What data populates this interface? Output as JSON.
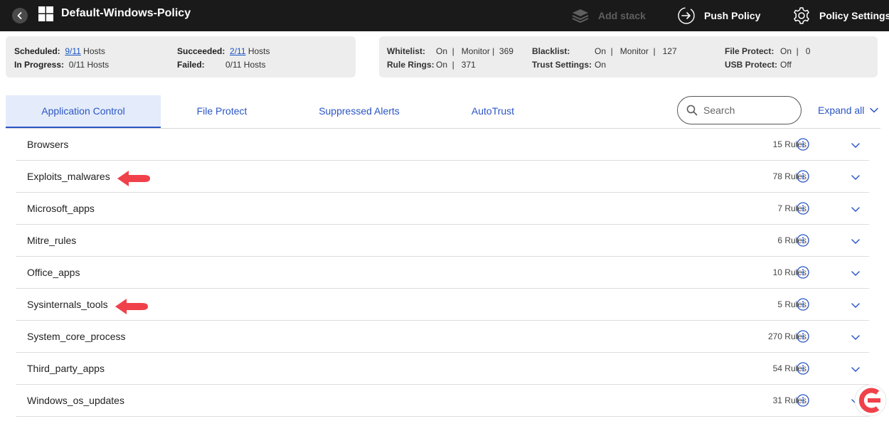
{
  "header": {
    "title": "Default-Windows-Policy",
    "add_stack": "Add stack",
    "push_policy": "Push Policy",
    "policy_settings": "Policy Settings"
  },
  "stats_left": {
    "scheduled_label": "Scheduled:",
    "scheduled_value": "9/11",
    "scheduled_suffix": "Hosts",
    "in_progress_label": "In Progress:",
    "in_progress_value": "0/11 Hosts",
    "succeeded_label": "Succeeded:",
    "succeeded_value": "2/11",
    "succeeded_suffix": "Hosts",
    "failed_label": "Failed:",
    "failed_value": "0/11 Hosts"
  },
  "stats_right": {
    "whitelist_label": "Whitelist:",
    "whitelist_value": "On  |   Monitor |  369",
    "rule_rings_label": "Rule Rings:",
    "rule_rings_value": "On  |   371",
    "blacklist_label": "Blacklist:",
    "blacklist_value": "On  |   Monitor  |   127",
    "trust_settings_label": "Trust Settings:",
    "trust_settings_value": "On",
    "file_protect_label": "File Protect:",
    "file_protect_value": "On  |   0",
    "usb_protect_label": "USB Protect:",
    "usb_protect_value": "Off"
  },
  "tabs": [
    {
      "label": "Application Control",
      "active": true
    },
    {
      "label": "File Protect"
    },
    {
      "label": "Suppressed Alerts"
    },
    {
      "label": "AutoTrust"
    }
  ],
  "search": {
    "placeholder": "Search"
  },
  "expand_all": "Expand all",
  "rule_groups": [
    {
      "name": "Browsers",
      "count": "15 Rules"
    },
    {
      "name": "Exploits_malwares",
      "count": "78 Rules",
      "annotated": true
    },
    {
      "name": "Microsoft_apps",
      "count": "7 Rules"
    },
    {
      "name": "Mitre_rules",
      "count": "6 Rules"
    },
    {
      "name": "Office_apps",
      "count": "10 Rules"
    },
    {
      "name": "Sysinternals_tools",
      "count": "5 Rules",
      "annotated": true
    },
    {
      "name": "System_core_process",
      "count": "270 Rules"
    },
    {
      "name": "Third_party_apps",
      "count": "54 Rules"
    },
    {
      "name": "Windows_os_updates",
      "count": "31 Rules"
    }
  ],
  "colors": {
    "accent": "#2b55c6",
    "topbar": "#1a1a1a",
    "annotation": "#f0414a",
    "panel": "#ededed"
  }
}
